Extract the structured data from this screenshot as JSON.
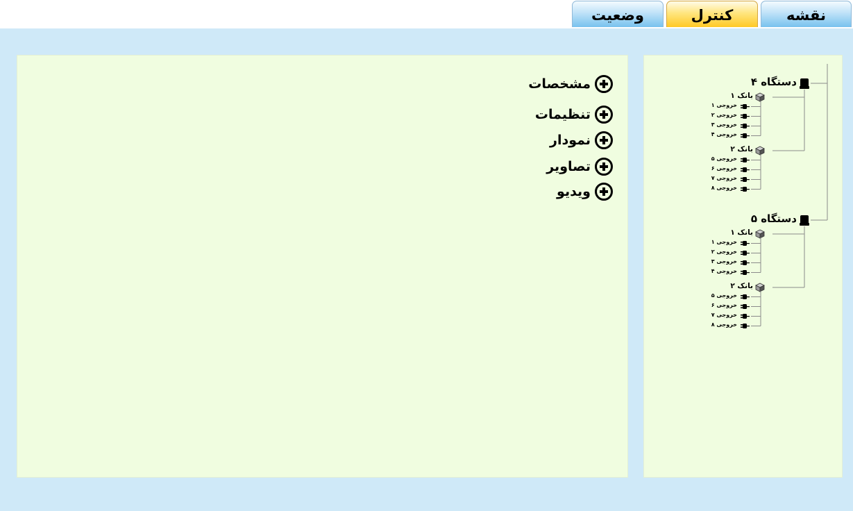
{
  "tabs": {
    "map": "نقشه",
    "control": "کنترل",
    "status": "وضعیت",
    "active": "control"
  },
  "tree": {
    "devices": [
      {
        "label": "دستگاه ۴",
        "icon": "device-icon",
        "banks": [
          {
            "label": "بانک ۱",
            "icon": "box-icon",
            "outputs": [
              "خروجی ۱",
              "خروجی ۲",
              "خروجی ۳",
              "خروجی ۴"
            ]
          },
          {
            "label": "بانک ۲",
            "icon": "box-icon",
            "outputs": [
              "خروجی ۵",
              "خروجی ۶",
              "خروجی ۷",
              "خروجی ۸"
            ]
          }
        ]
      },
      {
        "label": "دستگاه ۵",
        "icon": "device-icon",
        "banks": [
          {
            "label": "بانک ۱",
            "icon": "box-icon",
            "outputs": [
              "خروجی ۱",
              "خروجی ۲",
              "خروجی ۳",
              "خروجی ۴"
            ]
          },
          {
            "label": "بانک ۲",
            "icon": "box-icon",
            "outputs": [
              "خروجی ۵",
              "خروجی ۶",
              "خروجی ۷",
              "خروجی ۸"
            ]
          }
        ]
      }
    ],
    "output_icon": "plug-icon"
  },
  "sections": [
    {
      "label": "مشخصات",
      "icon": "plus-circle-icon"
    },
    {
      "label": "تنظیمات",
      "icon": "plus-circle-icon"
    },
    {
      "label": "نمودار",
      "icon": "plus-circle-icon"
    },
    {
      "label": "تصاویر",
      "icon": "plus-circle-icon"
    },
    {
      "label": "ویدیو",
      "icon": "plus-circle-icon"
    }
  ],
  "colors": {
    "background": "#cfe9f8",
    "panel": "#f0fde0",
    "tab_inactive": "#78c2ee",
    "tab_active": "#ffc926"
  }
}
